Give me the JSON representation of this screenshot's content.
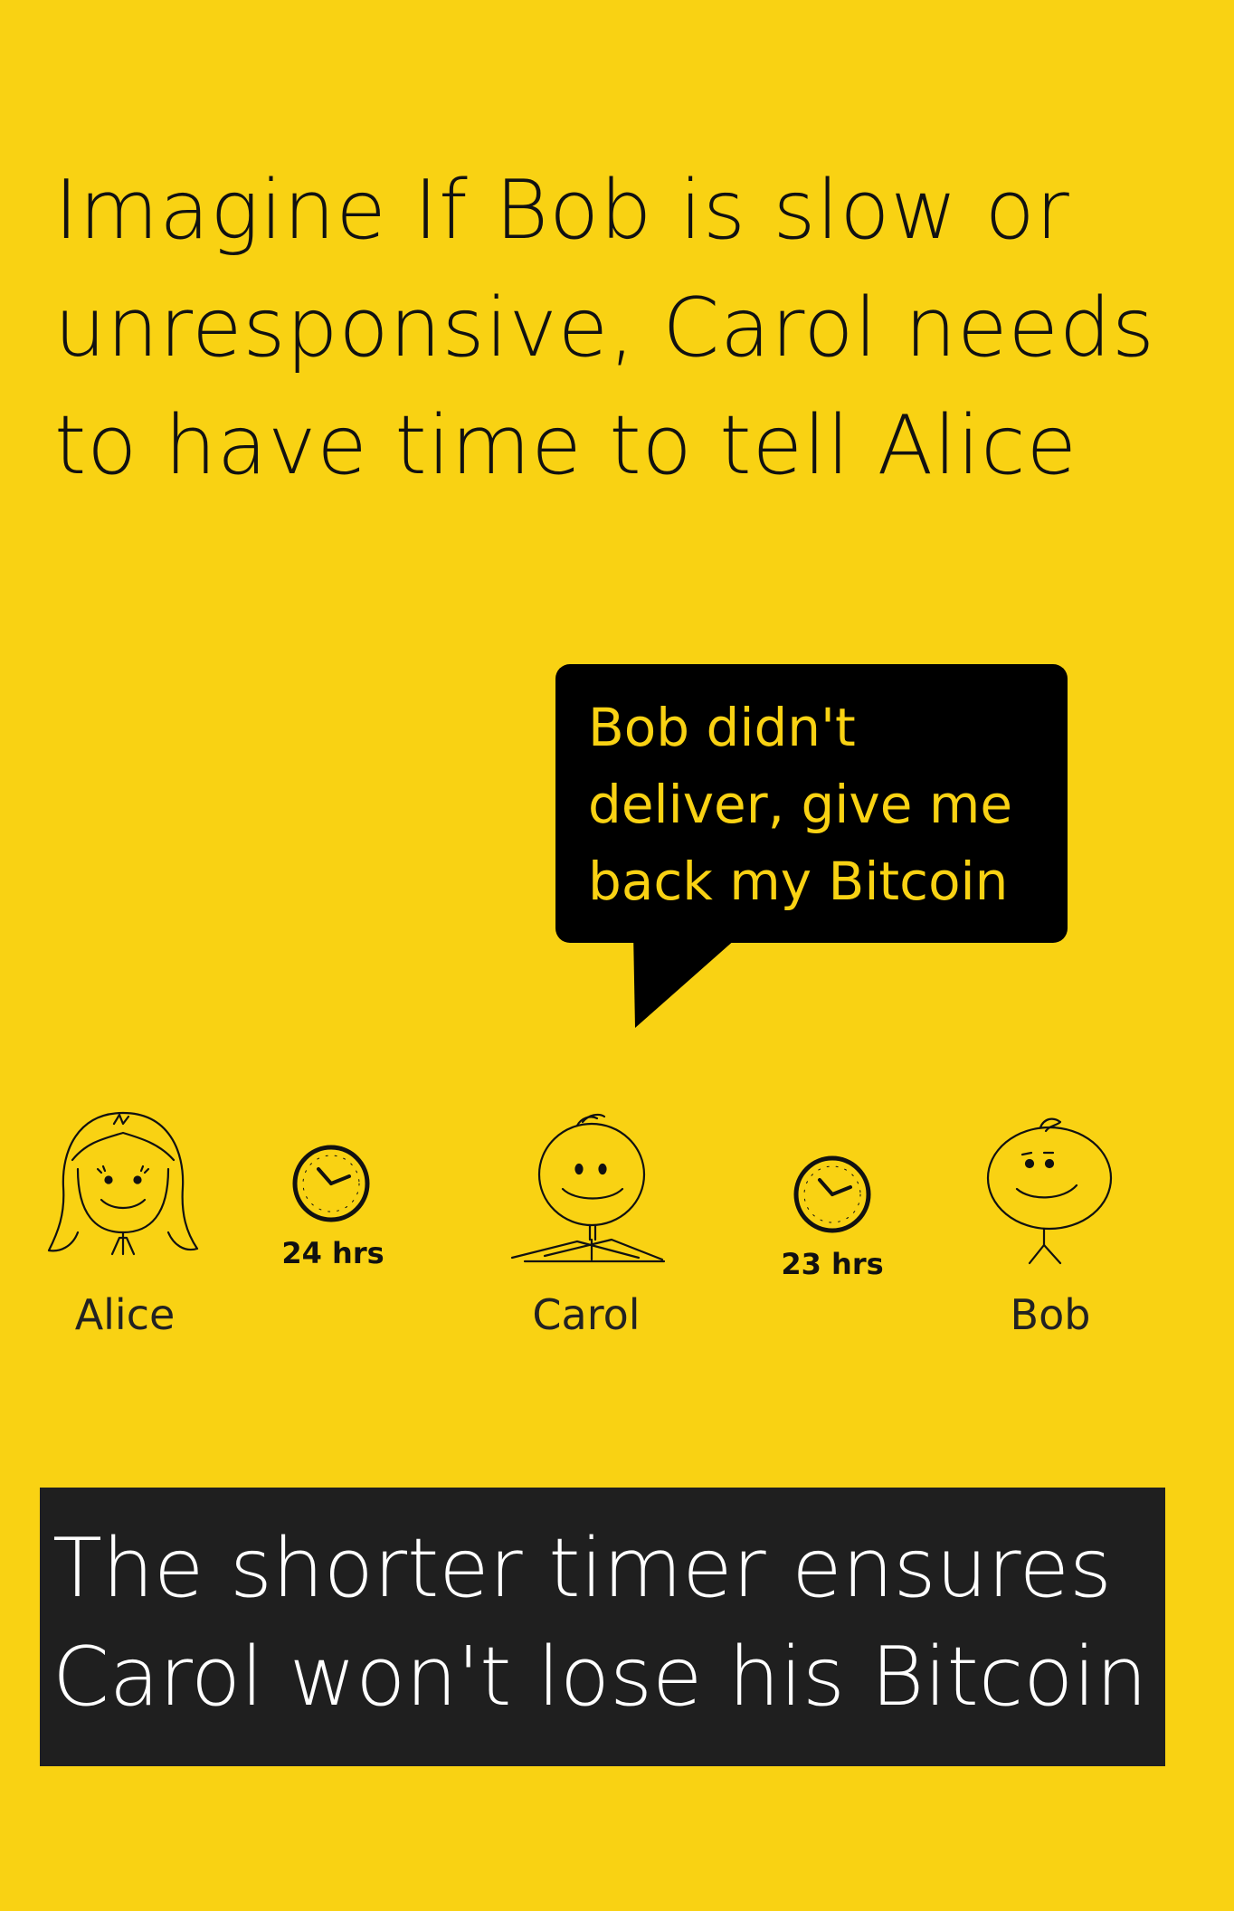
{
  "headline": "Imagine If Bob is slow or unresponsive, Carol needs to have time to tell Alice",
  "bubble": {
    "line1": "Bob didn't",
    "line2": "deliver, give me",
    "line3": "back my Bitcoin"
  },
  "characters": {
    "alice": "Alice",
    "carol": "Carol",
    "bob": "Bob"
  },
  "timers": {
    "alice_carol": "24 hrs",
    "carol_bob": "23 hrs"
  },
  "banner": {
    "line1": "The shorter timer ensures",
    "line2": "Carol won't lose his Bitcoin"
  },
  "colors": {
    "background": "#F9D213",
    "bubble": "#000000",
    "bubble_text": "#F9D213",
    "banner": "#1F1F1F",
    "banner_text": "#FFFFFF"
  }
}
